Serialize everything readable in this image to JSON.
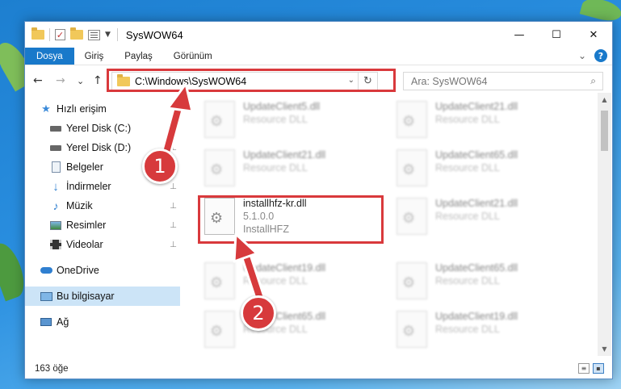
{
  "window": {
    "title": "SysWOW64",
    "controls": {
      "minimize": "—",
      "maximize": "☐",
      "close": "✕"
    }
  },
  "ribbon": {
    "tabs": [
      "Dosya",
      "Giriş",
      "Paylaş",
      "Görünüm"
    ],
    "expand_glyph": "⌄",
    "help_glyph": "?"
  },
  "navigation": {
    "back": "←",
    "forward": "→",
    "recent": "⌄",
    "up": "↑",
    "address": "C:\\Windows\\SysWOW64",
    "address_drop": "⌄",
    "refresh": "↻",
    "search_placeholder": "Ara: SysWOW64",
    "search_icon": "⌕"
  },
  "sidebar": {
    "items": [
      {
        "label": "Hızlı erişim",
        "icon": "star-icon",
        "pinned": false
      },
      {
        "label": "Yerel Disk (C:)",
        "icon": "drive-icon",
        "pinned": true
      },
      {
        "label": "Yerel Disk (D:)",
        "icon": "drive-icon",
        "pinned": true
      },
      {
        "label": "Belgeler",
        "icon": "documents-icon",
        "pinned": true
      },
      {
        "label": "İndirmeler",
        "icon": "download-icon",
        "pinned": true
      },
      {
        "label": "Müzik",
        "icon": "music-icon",
        "pinned": true
      },
      {
        "label": "Resimler",
        "icon": "pictures-icon",
        "pinned": true
      },
      {
        "label": "Videolar",
        "icon": "videos-icon",
        "pinned": true
      },
      {
        "label": "OneDrive",
        "icon": "cloud-icon",
        "pinned": false
      },
      {
        "label": "Bu bilgisayar",
        "icon": "computer-icon",
        "pinned": false,
        "selected": true
      },
      {
        "label": "Ağ",
        "icon": "network-icon",
        "pinned": false
      }
    ],
    "pin_glyph": "📌"
  },
  "files": {
    "left": [
      {
        "name": "UpdateClient5.dll",
        "type": "Resource DLL"
      },
      {
        "name": "UpdateClient21.dll",
        "type": "Resource DLL"
      },
      {
        "name": "installhfz-kr.dll",
        "version": "5.1.0.0",
        "type": "InstallHFZ",
        "selected": true
      },
      {
        "name": "UpdateClient19.dll",
        "type": "Resource DLL"
      },
      {
        "name": "UpdateClient65.dll",
        "type": "Resource DLL"
      }
    ],
    "right": [
      {
        "name": "UpdateClient21.dll",
        "type": "Resource DLL"
      },
      {
        "name": "UpdateClient65.dll",
        "type": "Resource DLL"
      },
      {
        "name": "UpdateClient21.dll",
        "type": "Resource DLL"
      },
      {
        "name": "UpdateClient65.dll",
        "type": "Resource DLL"
      },
      {
        "name": "UpdateClient19.dll",
        "type": "Resource DLL"
      }
    ]
  },
  "status": {
    "count": "163 öğe"
  },
  "annotations": {
    "step1": "1",
    "step2": "2",
    "color": "#d73a3c"
  },
  "colors": {
    "accent": "#1979ca",
    "highlight": "#d9393c",
    "selection": "#cce4f7"
  }
}
